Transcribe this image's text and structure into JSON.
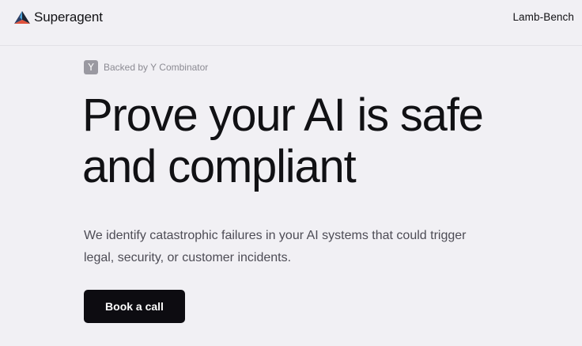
{
  "header": {
    "logo_text": "Superagent",
    "logo_icon": "superagent-prism-logo",
    "nav_link": "Lamb-Bench"
  },
  "badge": {
    "icon_letter": "Y",
    "text": "Backed by Y Combinator"
  },
  "hero": {
    "title_line1": "Prove your AI is safe",
    "title_line2": "and compliant",
    "subtitle_line1": "We identify catastrophic failures in your AI systems that could trigger",
    "subtitle_line2": "legal, security, or customer incidents.",
    "cta_label": "Book a call"
  },
  "colors": {
    "background": "#f1f0f4",
    "text": "#111114",
    "button": "#0d0c11",
    "badge_icon": "#9a99a1"
  }
}
